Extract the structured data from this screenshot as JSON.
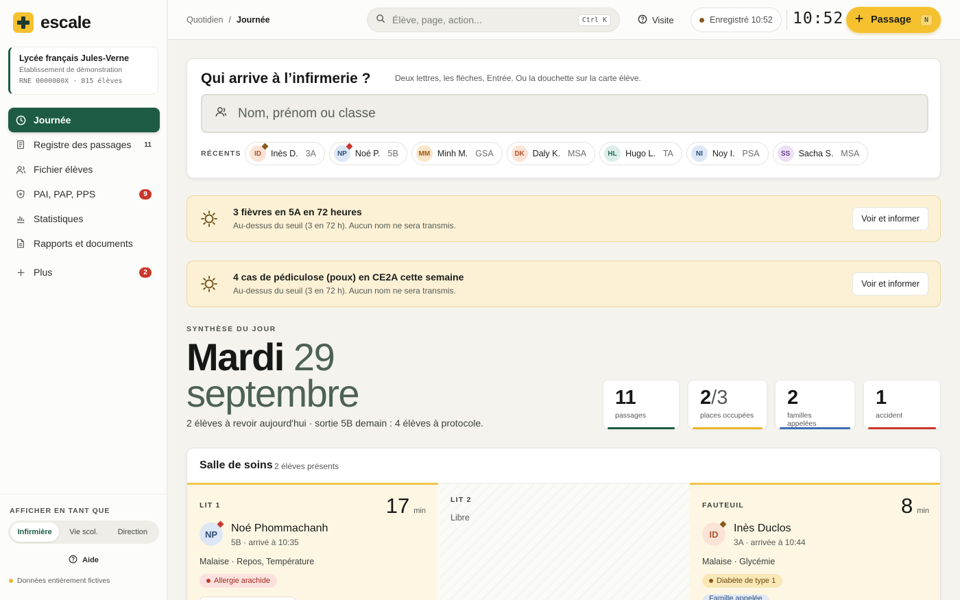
{
  "app": {
    "name": "escale"
  },
  "school": {
    "name": "Lycée français Jules-Verne",
    "subtitle": "Établissement de démonstration",
    "rne": "RNE 0000000X · 815 élèves"
  },
  "nav": {
    "items": [
      {
        "label": "Journée",
        "icon": "clock-icon",
        "badge": ""
      },
      {
        "label": "Registre des passages",
        "icon": "document-icon",
        "badge": "11"
      },
      {
        "label": "Fichier élèves",
        "icon": "users-icon",
        "badge": ""
      },
      {
        "label": "PAI, PAP, PPS",
        "icon": "shield-icon",
        "badge": "9"
      },
      {
        "label": "Statistiques",
        "icon": "bar-chart-icon",
        "badge": ""
      },
      {
        "label": "Rapports et documents",
        "icon": "report-icon",
        "badge": ""
      },
      {
        "label": "Plus",
        "icon": "plus-icon",
        "badge": "2"
      }
    ]
  },
  "view_as": {
    "label": "AFFICHER EN TANT QUE",
    "options": [
      "Infirmière",
      "Vie scol.",
      "Direction"
    ],
    "selected": "Infirmière"
  },
  "help": {
    "label": "Aide"
  },
  "footer_note": "Données entièrement fictives",
  "topbar": {
    "breadcrumb": [
      "Quotidien",
      "/",
      "Journée"
    ],
    "search_placeholder": "Élève, page, action...",
    "search_kbd": "Ctrl K",
    "visite_label": "Visite",
    "saved_label": "Enregistré 10:52",
    "clock": "10:52",
    "passage_label": "Passage",
    "passage_kbd": "N"
  },
  "arrival": {
    "title": "Qui arrive à l’infirmerie ?",
    "hint": "Deux lettres, les flèches, Entrée. Ou la douchette sur la carte élève.",
    "input_placeholder": "Nom, prénom ou classe",
    "recent_label": "RÉCENTS",
    "recent": [
      {
        "initials": "ID",
        "name": "Inès D.",
        "class": "3A",
        "bg": "#fbe3d6",
        "fg": "#b0532a",
        "flag": "#8a5a1f"
      },
      {
        "initials": "NP",
        "name": "Noé P.",
        "class": "5B",
        "bg": "#dde7f6",
        "fg": "#2d4f7a",
        "flag": "#c9362b"
      },
      {
        "initials": "MM",
        "name": "Minh M.",
        "class": "GSA",
        "bg": "#f9e6c9",
        "fg": "#9a5b16",
        "flag": ""
      },
      {
        "initials": "DK",
        "name": "Daly K.",
        "class": "MSA",
        "bg": "#fbe3d6",
        "fg": "#b0532a",
        "flag": ""
      },
      {
        "initials": "HL",
        "name": "Hugo L.",
        "class": "TA",
        "bg": "#dbeee9",
        "fg": "#2a6b59",
        "flag": ""
      },
      {
        "initials": "NI",
        "name": "Noy I.",
        "class": "PSA",
        "bg": "#dde7f6",
        "fg": "#2d4f7a",
        "flag": ""
      },
      {
        "initials": "SS",
        "name": "Sacha S.",
        "class": "MSA",
        "bg": "#ece0f4",
        "fg": "#6a3b8a",
        "flag": ""
      }
    ]
  },
  "alerts": [
    {
      "title": "3 fièvres en 5A en 72 heures",
      "subtitle": "Au-dessus du seuil (3 en 72 h). Aucun nom ne sera transmis.",
      "button": "Voir et informer",
      "icon": "sun-icon"
    },
    {
      "title": "4 cas de pédiculose (poux) en CE2A cette semaine",
      "subtitle": "Au-dessus du seuil (3 en 72 h). Aucun nom ne sera transmis.",
      "button": "Voir et informer",
      "icon": "sun-icon"
    }
  ],
  "synthesis": {
    "label": "SYNTHÈSE DU JOUR",
    "weekday": "Mardi",
    "day": "29",
    "month": "septembre",
    "summary": "2 élèves à revoir aujourd'hui · sortie 5B demain : 4 élèves à protocole."
  },
  "stats": [
    {
      "value": "11",
      "suffix": "",
      "label": "passages",
      "color": "#1d5b45"
    },
    {
      "value": "2",
      "suffix": "/3",
      "label": "places occupées",
      "color": "#e8b62a"
    },
    {
      "value": "2",
      "suffix": "",
      "label": "familles appelées",
      "color": "#3b6cb5"
    },
    {
      "value": "1",
      "suffix": "",
      "label": "accident",
      "color": "#c9362b"
    }
  ],
  "room": {
    "title": "Salle de soins",
    "subtitle": "2 élèves présents",
    "beds": [
      {
        "label": "LIT 1",
        "minutes": "17",
        "unit": "min",
        "initials": "NP",
        "name": "Noé Phommachanh",
        "meta": "5B · arrivé à 10:35",
        "reason": "Malaise · Repos, Température",
        "tag": "Allergie arachide"
      },
      {
        "label": "LIT 2",
        "free_text": "Libre"
      },
      {
        "label": "FAUTEUIL",
        "minutes": "8",
        "unit": "min",
        "initials": "ID",
        "name": "Inès Duclos",
        "meta": "3A · arrivée à 10:44",
        "reason": "Malaise · Glycémie",
        "tag": "Diabète de type 1",
        "tag2": "Famille appelée"
      }
    ]
  }
}
